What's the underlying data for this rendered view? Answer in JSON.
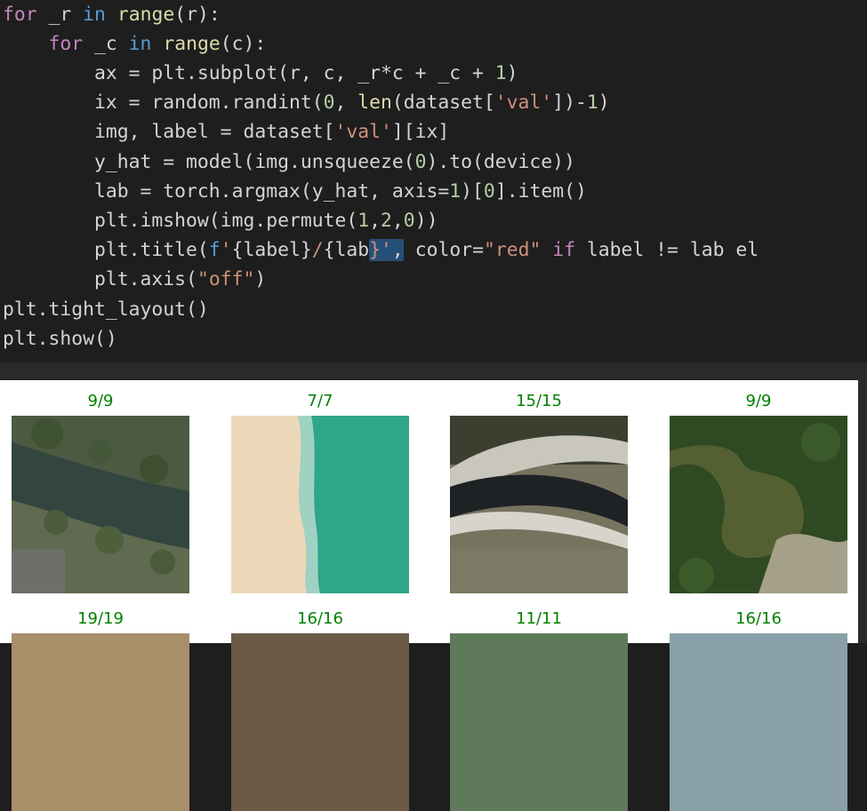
{
  "code": {
    "lines": [
      [
        {
          "t": "for",
          "c": "kw"
        },
        {
          "t": " _r ",
          "c": ""
        },
        {
          "t": "in",
          "c": "kw-blue"
        },
        {
          "t": " ",
          "c": ""
        },
        {
          "t": "range",
          "c": "fn"
        },
        {
          "t": "(r):",
          "c": ""
        }
      ],
      [
        {
          "t": "    ",
          "c": ""
        },
        {
          "t": "for",
          "c": "kw"
        },
        {
          "t": " _c ",
          "c": ""
        },
        {
          "t": "in",
          "c": "kw-blue"
        },
        {
          "t": " ",
          "c": ""
        },
        {
          "t": "range",
          "c": "fn"
        },
        {
          "t": "(c):",
          "c": ""
        }
      ],
      [
        {
          "t": "        ax = plt.subplot(r, c, _r*c + _c + ",
          "c": ""
        },
        {
          "t": "1",
          "c": "num"
        },
        {
          "t": ")",
          "c": ""
        }
      ],
      [
        {
          "t": "        ix = random.randint(",
          "c": ""
        },
        {
          "t": "0",
          "c": "num"
        },
        {
          "t": ", ",
          "c": ""
        },
        {
          "t": "len",
          "c": "fn"
        },
        {
          "t": "(dataset[",
          "c": ""
        },
        {
          "t": "'val'",
          "c": "str"
        },
        {
          "t": "])-",
          "c": ""
        },
        {
          "t": "1",
          "c": "num"
        },
        {
          "t": ")",
          "c": ""
        }
      ],
      [
        {
          "t": "        img, label = dataset[",
          "c": ""
        },
        {
          "t": "'val'",
          "c": "str"
        },
        {
          "t": "][ix]",
          "c": ""
        }
      ],
      [
        {
          "t": "        y_hat = model(img.unsqueeze(",
          "c": ""
        },
        {
          "t": "0",
          "c": "num"
        },
        {
          "t": ").to(device))",
          "c": ""
        }
      ],
      [
        {
          "t": "        lab = torch.argmax(y_hat, axis=",
          "c": ""
        },
        {
          "t": "1",
          "c": "num"
        },
        {
          "t": ")[",
          "c": ""
        },
        {
          "t": "0",
          "c": "num"
        },
        {
          "t": "].item()",
          "c": ""
        }
      ],
      [
        {
          "t": "        plt.imshow(img.permute(",
          "c": ""
        },
        {
          "t": "1",
          "c": "num"
        },
        {
          "t": ",",
          "c": ""
        },
        {
          "t": "2",
          "c": "num"
        },
        {
          "t": ",",
          "c": ""
        },
        {
          "t": "0",
          "c": "num"
        },
        {
          "t": "))",
          "c": ""
        }
      ],
      [
        {
          "t": "        plt.title(",
          "c": ""
        },
        {
          "t": "f",
          "c": "kw-blue"
        },
        {
          "t": "'",
          "c": "str"
        },
        {
          "t": "{label}",
          "c": ""
        },
        {
          "t": "/",
          "c": "str"
        },
        {
          "t": "{lab",
          "c": ""
        },
        {
          "t": "}'",
          "c": "str sel"
        },
        {
          "t": ",",
          "c": "sel"
        },
        {
          "t": " color=",
          "c": ""
        },
        {
          "t": "\"red\"",
          "c": "str"
        },
        {
          "t": " ",
          "c": ""
        },
        {
          "t": "if",
          "c": "kw"
        },
        {
          "t": " label != lab el",
          "c": ""
        }
      ],
      [
        {
          "t": "        plt.axis(",
          "c": ""
        },
        {
          "t": "\"off\"",
          "c": "str"
        },
        {
          "t": ")",
          "c": ""
        }
      ],
      [
        {
          "t": "plt.tight_layout()",
          "c": ""
        }
      ],
      [
        {
          "t": "plt.show()",
          "c": ""
        }
      ]
    ]
  },
  "output": {
    "title_color": "#008000",
    "subplots": [
      {
        "title": "9/9",
        "kind": "river"
      },
      {
        "title": "7/7",
        "kind": "beach"
      },
      {
        "title": "15/15",
        "kind": "freeway"
      },
      {
        "title": "9/9",
        "kind": "pond"
      },
      {
        "title": "19/19",
        "kind": "brown"
      },
      {
        "title": "16/16",
        "kind": "brown2"
      },
      {
        "title": "11/11",
        "kind": "green"
      },
      {
        "title": "16/16",
        "kind": "light"
      }
    ]
  }
}
